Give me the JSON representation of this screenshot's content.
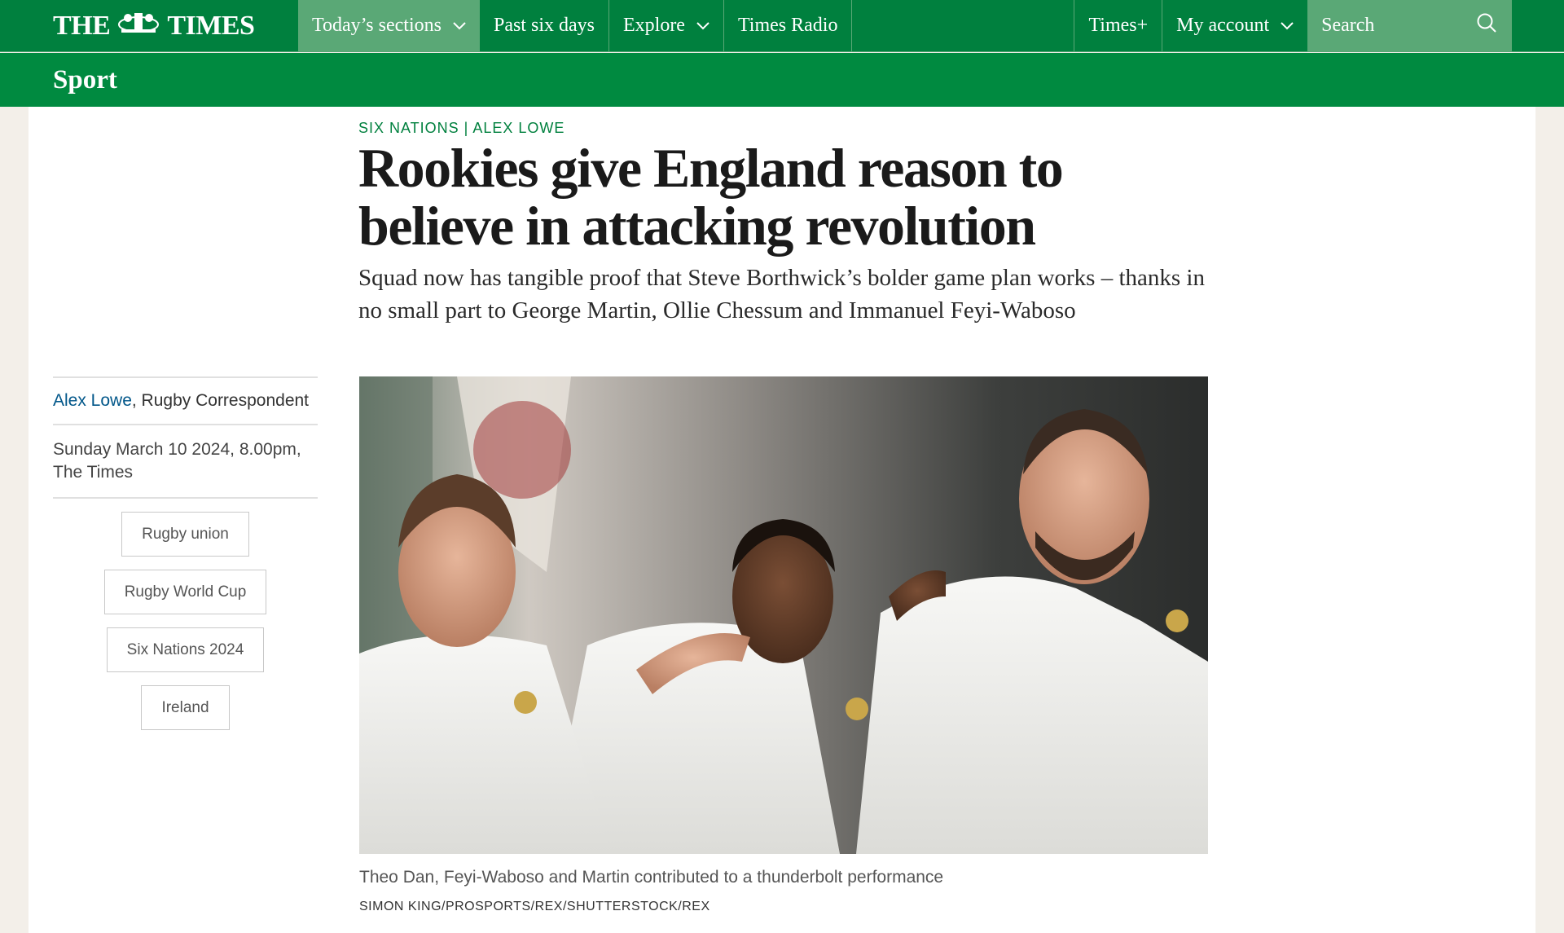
{
  "nav": {
    "logo_left": "THE",
    "logo_right": "TIMES",
    "items": [
      {
        "label": "Today’s sections",
        "has_dropdown": true
      },
      {
        "label": "Past six days",
        "has_dropdown": false
      },
      {
        "label": "Explore",
        "has_dropdown": true
      },
      {
        "label": "Times Radio",
        "has_dropdown": false
      }
    ],
    "right_items": [
      {
        "label": "Times+",
        "has_dropdown": false
      },
      {
        "label": "My account",
        "has_dropdown": true
      }
    ],
    "search_placeholder": "Search",
    "brand_color": "#00803e"
  },
  "section": {
    "title": "Sport"
  },
  "article": {
    "kicker": "SIX NATIONS | ALEX LOWE",
    "headline": "Rookies give England reason to believe in attacking revolution",
    "standfirst": "Squad now has tangible proof that Steve Borthwick’s bolder game plan works – thanks in no small part to George Martin, Ollie Chessum and Immanuel Feyi-Waboso",
    "author_name": "Alex Lowe",
    "author_role": ", Rugby Correspondent",
    "date": "Sunday March 10 2024, 8.00pm, The Times",
    "tags": [
      "Rugby union",
      "Rugby World Cup",
      "Six Nations 2024",
      "Ireland"
    ],
    "image_caption": "Theo Dan, Feyi-Waboso and Martin contributed to a thunderbolt performance",
    "image_credit": "SIMON KING/PROSPORTS/REX/SHUTTERSTOCK/REX"
  }
}
